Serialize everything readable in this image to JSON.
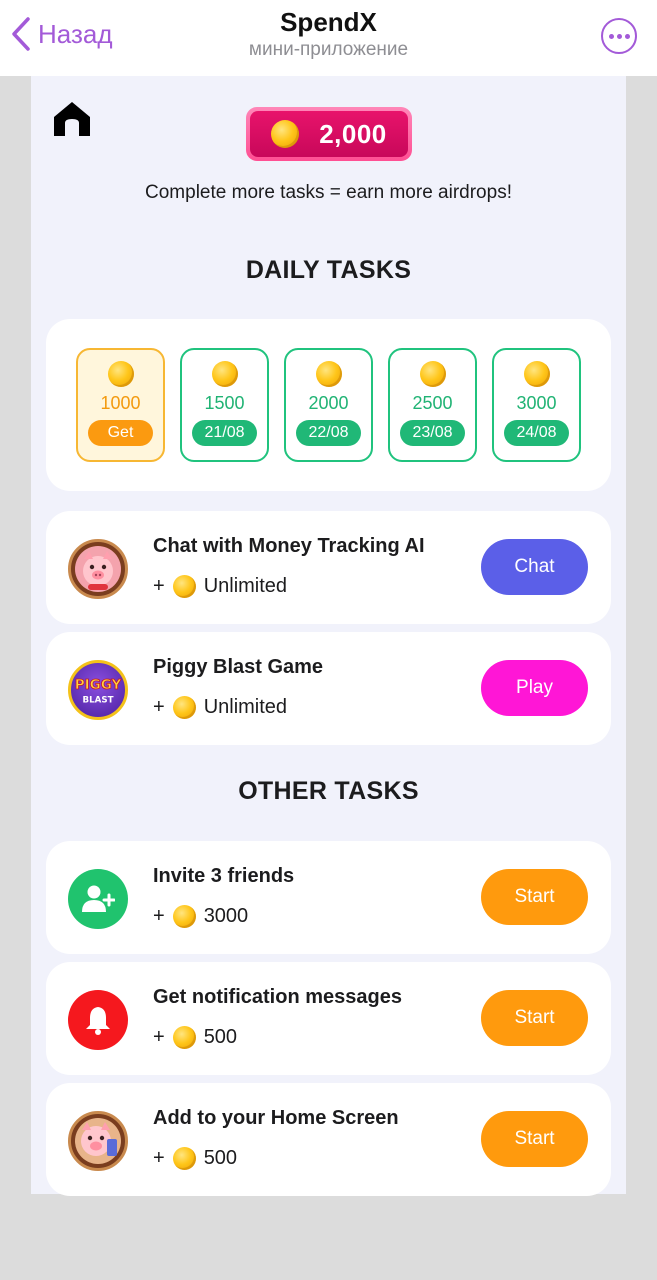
{
  "header": {
    "back_label": "Назад",
    "title": "SpendX",
    "subtitle": "мини-приложение",
    "back_icon": "chevron-left-icon",
    "more_icon": "more-dots-icon"
  },
  "colors": {
    "accent": "#a35ad8",
    "daily_green": "#20b877",
    "active_orange": "#fb9a10",
    "chat_button": "#5b5fe8",
    "play_button": "#ff16d6",
    "start_button": "#ff9a0d",
    "balance_pink": "#e8136b"
  },
  "balance": {
    "amount": "2,000",
    "tagline": "Complete more tasks = earn more airdrops!"
  },
  "daily": {
    "title": "DAILY TASKS",
    "days": [
      {
        "amount": "1000",
        "label": "Get",
        "active": true
      },
      {
        "amount": "1500",
        "label": "21/08",
        "active": false
      },
      {
        "amount": "2000",
        "label": "22/08",
        "active": false
      },
      {
        "amount": "2500",
        "label": "23/08",
        "active": false
      },
      {
        "amount": "3000",
        "label": "24/08",
        "active": false
      }
    ],
    "tasks": [
      {
        "name": "Chat with Money Tracking AI",
        "plus": "+",
        "reward": "Unlimited",
        "button": "Chat",
        "icon": "pig-avatar-icon"
      },
      {
        "name": "Piggy Blast Game",
        "plus": "+",
        "reward": "Unlimited",
        "button": "Play",
        "icon": "piggy-blast-logo-icon",
        "logo_text": "PIGGY BLAST"
      }
    ]
  },
  "other": {
    "title": "OTHER TASKS",
    "tasks": [
      {
        "name": "Invite 3 friends",
        "plus": "+",
        "reward": "3000",
        "button": "Start",
        "icon": "add-user-icon"
      },
      {
        "name": "Get notification messages",
        "plus": "+",
        "reward": "500",
        "button": "Start",
        "icon": "bell-icon"
      },
      {
        "name": "Add to your Home Screen",
        "plus": "+",
        "reward": "500",
        "button": "Start",
        "icon": "pig-phone-icon"
      }
    ]
  }
}
